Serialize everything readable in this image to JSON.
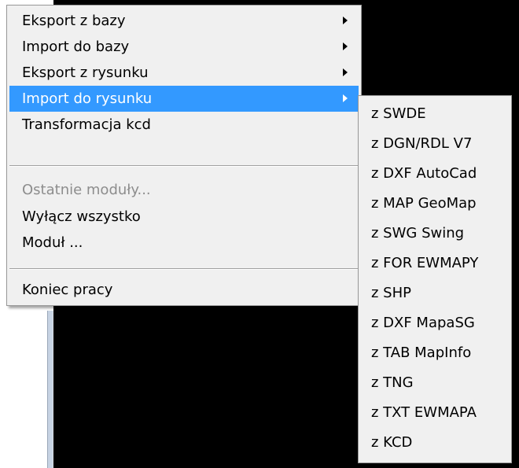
{
  "main_menu": {
    "items": [
      {
        "label": "Eksport z bazy",
        "has_submenu": true
      },
      {
        "label": "Import do bazy",
        "has_submenu": true
      },
      {
        "label": "Eksport z rysunku",
        "has_submenu": true
      },
      {
        "label": "Import do rysunku",
        "has_submenu": true,
        "highlighted": true
      },
      {
        "label": "Transformacja kcd",
        "has_submenu": false
      },
      {
        "label": "Ostatnie moduły...",
        "has_submenu": false,
        "disabled": true
      },
      {
        "label": "Wyłącz wszystko",
        "has_submenu": false
      },
      {
        "label": "Moduł ...",
        "has_submenu": false
      },
      {
        "label": "Koniec pracy",
        "has_submenu": false
      }
    ]
  },
  "submenu": {
    "items": [
      {
        "label": "z SWDE"
      },
      {
        "label": "z DGN/RDL V7"
      },
      {
        "label": "z DXF AutoCad"
      },
      {
        "label": "z MAP GeoMap"
      },
      {
        "label": "z SWG Swing"
      },
      {
        "label": "z FOR EWMAPY"
      },
      {
        "label": "z SHP"
      },
      {
        "label": "z DXF MapaSG"
      },
      {
        "label": "z TAB MapInfo"
      },
      {
        "label": "z TNG"
      },
      {
        "label": "z TXT EWMAPA"
      },
      {
        "label": "z KCD"
      }
    ]
  },
  "colors": {
    "highlight": "#3399ff",
    "menu_background": "#f0f0f0",
    "disabled_text": "#8d8d8d",
    "canvas": "#000000"
  },
  "icons": {
    "submenu_arrow": "triangle-right"
  }
}
